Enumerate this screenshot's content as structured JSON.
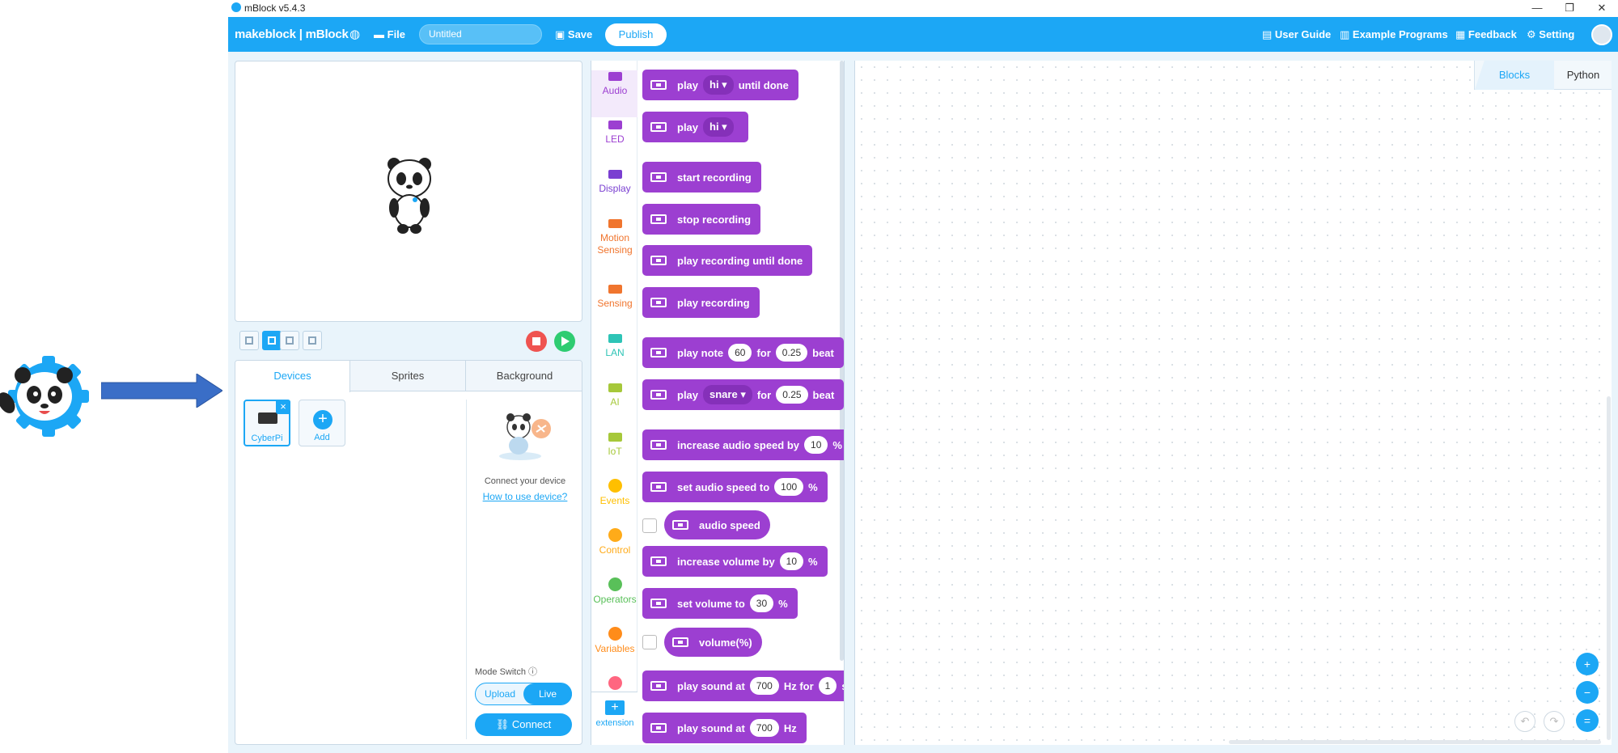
{
  "window": {
    "title": "mBlock v5.4.3",
    "min": "—",
    "restore": "❐",
    "close": "✕"
  },
  "menubar": {
    "logo": "makeblock | mBlock",
    "file": "File",
    "project_title": "Untitled",
    "save": "Save",
    "publish": "Publish",
    "user_guide": "User Guide",
    "example_programs": "Example Programs",
    "feedback": "Feedback",
    "setting": "Setting"
  },
  "devices": {
    "tabs": [
      "Devices",
      "Sprites",
      "Background"
    ],
    "tiles": [
      {
        "label": "CyberPi"
      },
      {
        "label": "Add"
      }
    ],
    "connect_text": "Connect your device",
    "howto_link": "How to use device?",
    "mode_switch_label": "Mode Switch",
    "mode_upload": "Upload",
    "mode_live": "Live",
    "connect_button": "Connect"
  },
  "categories": [
    {
      "label": "Audio",
      "color": "#9c3fd1"
    },
    {
      "label": "LED",
      "color": "#9c3fd1"
    },
    {
      "label": "Display",
      "color": "#7a3fd1"
    },
    {
      "label": "Motion Sensing",
      "color": "#f0752e"
    },
    {
      "label": "Sensing",
      "color": "#f0752e"
    },
    {
      "label": "LAN",
      "color": "#2ec4b6"
    },
    {
      "label": "AI",
      "color": "#a6c83a"
    },
    {
      "label": "IoT",
      "color": "#a6c83a"
    },
    {
      "label": "Events",
      "color": "#ffbf00"
    },
    {
      "label": "Control",
      "color": "#ffab19"
    },
    {
      "label": "Operators",
      "color": "#59c059"
    },
    {
      "label": "Variables",
      "color": "#ff8c1a"
    }
  ],
  "extension_label": "extension",
  "blocks": {
    "b1": {
      "w1": "play",
      "d1": "hi ▾",
      "w2": "until done"
    },
    "b2": {
      "w1": "play",
      "d1": "hi ▾"
    },
    "b3": {
      "w1": "start recording"
    },
    "b4": {
      "w1": "stop recording"
    },
    "b5": {
      "w1": "play recording until done"
    },
    "b6": {
      "w1": "play recording"
    },
    "b7": {
      "w1": "play note",
      "p1": "60",
      "w2": "for",
      "p2": "0.25",
      "w3": "beat"
    },
    "b8": {
      "w1": "play",
      "d1": "snare ▾",
      "w2": "for",
      "p1": "0.25",
      "w3": "beat"
    },
    "b9": {
      "w1": "increase audio speed by",
      "p1": "10",
      "w2": "%"
    },
    "b10": {
      "w1": "set audio speed to",
      "p1": "100",
      "w2": "%"
    },
    "b11": {
      "w1": "audio speed"
    },
    "b12": {
      "w1": "increase volume by",
      "p1": "10",
      "w2": "%"
    },
    "b13": {
      "w1": "set volume to",
      "p1": "30",
      "w2": "%"
    },
    "b14": {
      "w1": "volume(%)"
    },
    "b15": {
      "w1": "play sound at",
      "p1": "700",
      "w2": "Hz for",
      "p2": "1",
      "w3": "sec"
    },
    "b16": {
      "w1": "play sound at",
      "p1": "700",
      "w2": "Hz"
    }
  },
  "workspace": {
    "tab_blocks": "Blocks",
    "tab_python": "Python",
    "zoom_in": "+",
    "zoom_out": "−",
    "zoom_reset": "=",
    "undo": "↶",
    "redo": "↷"
  }
}
